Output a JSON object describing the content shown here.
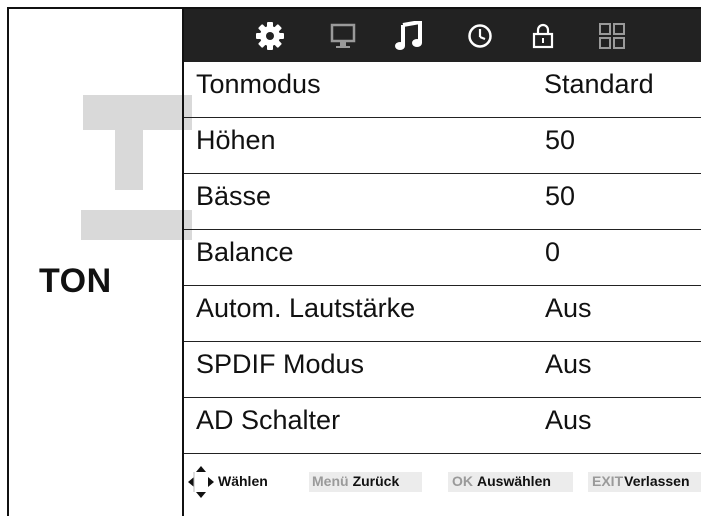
{
  "page_title": "TON",
  "icons": [
    {
      "name": "gear-icon",
      "color": "#ffffff"
    },
    {
      "name": "monitor-icon",
      "color": "#9a9a9a"
    },
    {
      "name": "music-note-icon",
      "color": "#ffffff"
    },
    {
      "name": "clock-icon",
      "color": "#ffffff"
    },
    {
      "name": "lock-icon",
      "color": "#ffffff"
    },
    {
      "name": "apps-grid-icon",
      "color": "#9a9a9a"
    }
  ],
  "menu": {
    "items": [
      {
        "label": "Tonmodus",
        "value": "Standard"
      },
      {
        "label": "Höhen",
        "value": "50"
      },
      {
        "label": "Bässe",
        "value": "50"
      },
      {
        "label": "Balance",
        "value": "0"
      },
      {
        "label": "Autom. Lautstärke",
        "value": "Aus"
      },
      {
        "label": "SPDIF Modus",
        "value": "Aus"
      },
      {
        "label": "AD Schalter",
        "value": "Aus"
      }
    ]
  },
  "footer": {
    "select": {
      "key": "",
      "label": "Wählen"
    },
    "back": {
      "key": "Menü",
      "label": "Zurück"
    },
    "ok": {
      "key": "OK",
      "label": "Auswählen"
    },
    "exit": {
      "key": "EXIT",
      "label": "Verlassen"
    }
  }
}
